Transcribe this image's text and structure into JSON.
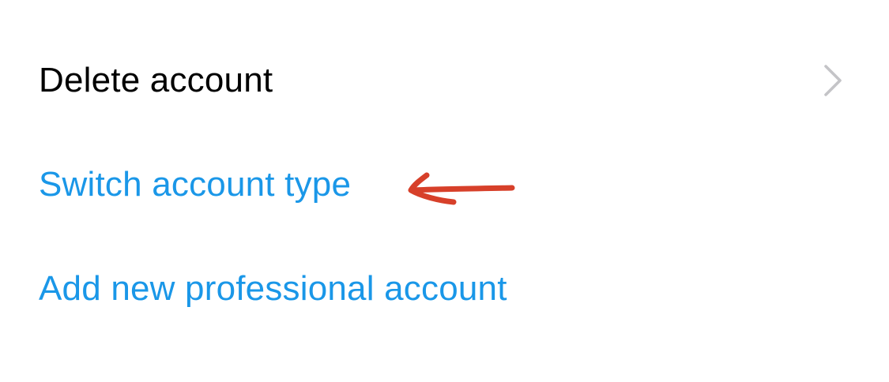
{
  "menu": {
    "items": [
      {
        "label": "Delete account",
        "color": "#000000",
        "has_chevron": true,
        "chevron_icon": "chevron-right-icon"
      },
      {
        "label": "Switch account type",
        "color": "#1a97e8"
      },
      {
        "label": "Add new professional account",
        "color": "#1a97e8"
      }
    ]
  },
  "annotation": {
    "arrow_icon": "hand-drawn-arrow-left-icon",
    "arrow_color": "#d7402a"
  },
  "colors": {
    "background": "#ffffff",
    "link_blue": "#1a97e8",
    "chevron_gray": "#c4c4c7"
  }
}
